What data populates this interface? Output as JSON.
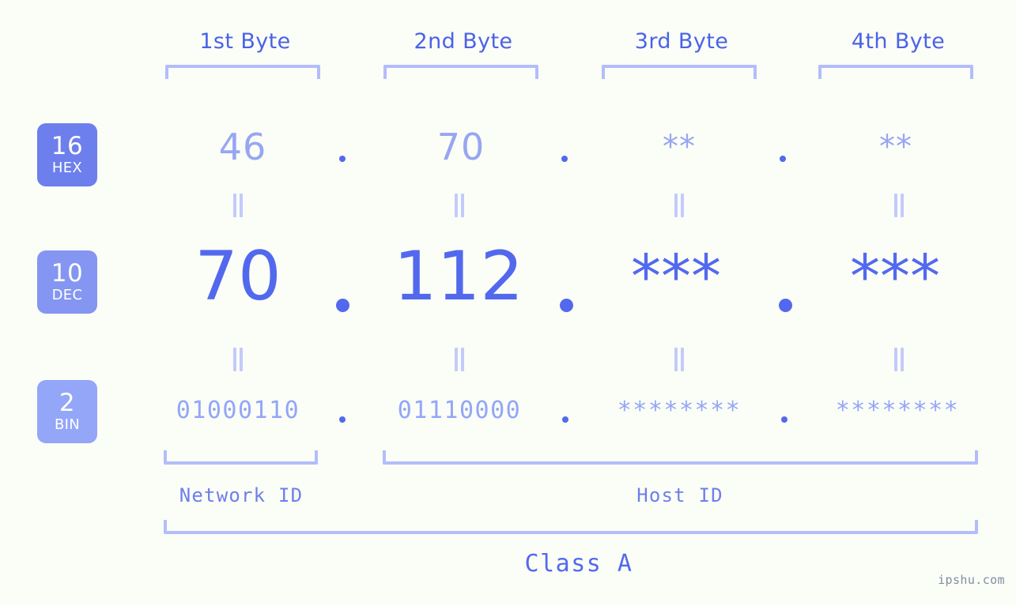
{
  "meta": {
    "background_color": "#fbfdf7",
    "accent_color": "#5269ee",
    "accent_light_color": "#93a6f7",
    "bracket_color": "#b3bdfb",
    "watermark": "ipshu.com"
  },
  "byte_headers": [
    {
      "label": "1st Byte"
    },
    {
      "label": "2nd Byte"
    },
    {
      "label": "3rd Byte"
    },
    {
      "label": "4th Byte"
    }
  ],
  "rows": [
    {
      "badge_number": "16",
      "badge_name": "HEX",
      "badge_color": "#6d7fec",
      "values": [
        "46",
        "70",
        "**",
        "**"
      ],
      "separators": [
        ".",
        ".",
        "."
      ]
    },
    {
      "badge_number": "10",
      "badge_name": "DEC",
      "badge_color": "#8496f1",
      "values": [
        "70",
        "112",
        "***",
        "***"
      ],
      "separators": [
        ".",
        ".",
        "."
      ]
    },
    {
      "badge_number": "2",
      "badge_name": "BIN",
      "badge_color": "#93a6f7",
      "values": [
        "01000110",
        "01110000",
        "********",
        "********"
      ],
      "separators": [
        ".",
        ".",
        "."
      ]
    }
  ],
  "equivalence_symbol": "=",
  "id_sections": [
    {
      "label": "Network ID"
    },
    {
      "label": "Host ID"
    }
  ],
  "class": {
    "label": "Class A"
  }
}
